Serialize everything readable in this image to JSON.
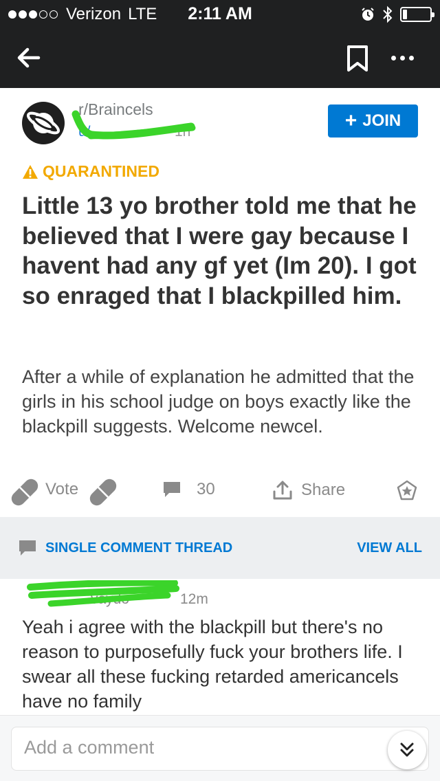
{
  "status_bar": {
    "carrier": "Verizon",
    "network": "LTE",
    "time": "2:11 AM",
    "signal_bars": 3,
    "battery_level": 0.15
  },
  "nav": {
    "back_icon": "back-arrow-icon",
    "save_icon": "bookmark-icon",
    "more_icon": "more-options-icon"
  },
  "post": {
    "subreddit": "r/Braincels",
    "author": "u/",
    "age": "1h",
    "join_label": "JOIN",
    "quarantine_label": "QUARANTINED",
    "title": "Little 13 yo brother told me that he believed that I were gay because I havent had any gf yet (Im 20). I got so enraged that I blackpilled him.",
    "body": "After a while of explanation he admitted that the girls in his school judge on boys exactly like the blackpill suggests. Welcome newcel.",
    "vote_label": "Vote",
    "comment_count": "30",
    "share_label": "Share"
  },
  "thread": {
    "title": "SINGLE COMMENT THREAD",
    "view_all": "VIEW ALL"
  },
  "comment": {
    "author": "vaydo",
    "age": "12m",
    "text": "Yeah i agree with the blackpill but there's no reason to purposefully fuck your brothers life. I swear all these fucking retarded americancels have no family"
  },
  "composer": {
    "placeholder": "Add a comment"
  },
  "colors": {
    "header_bg": "#1f2021",
    "accent_blue": "#0079d3",
    "quarantine_orange": "#f2a900",
    "scribble_green": "#3bd42a"
  }
}
